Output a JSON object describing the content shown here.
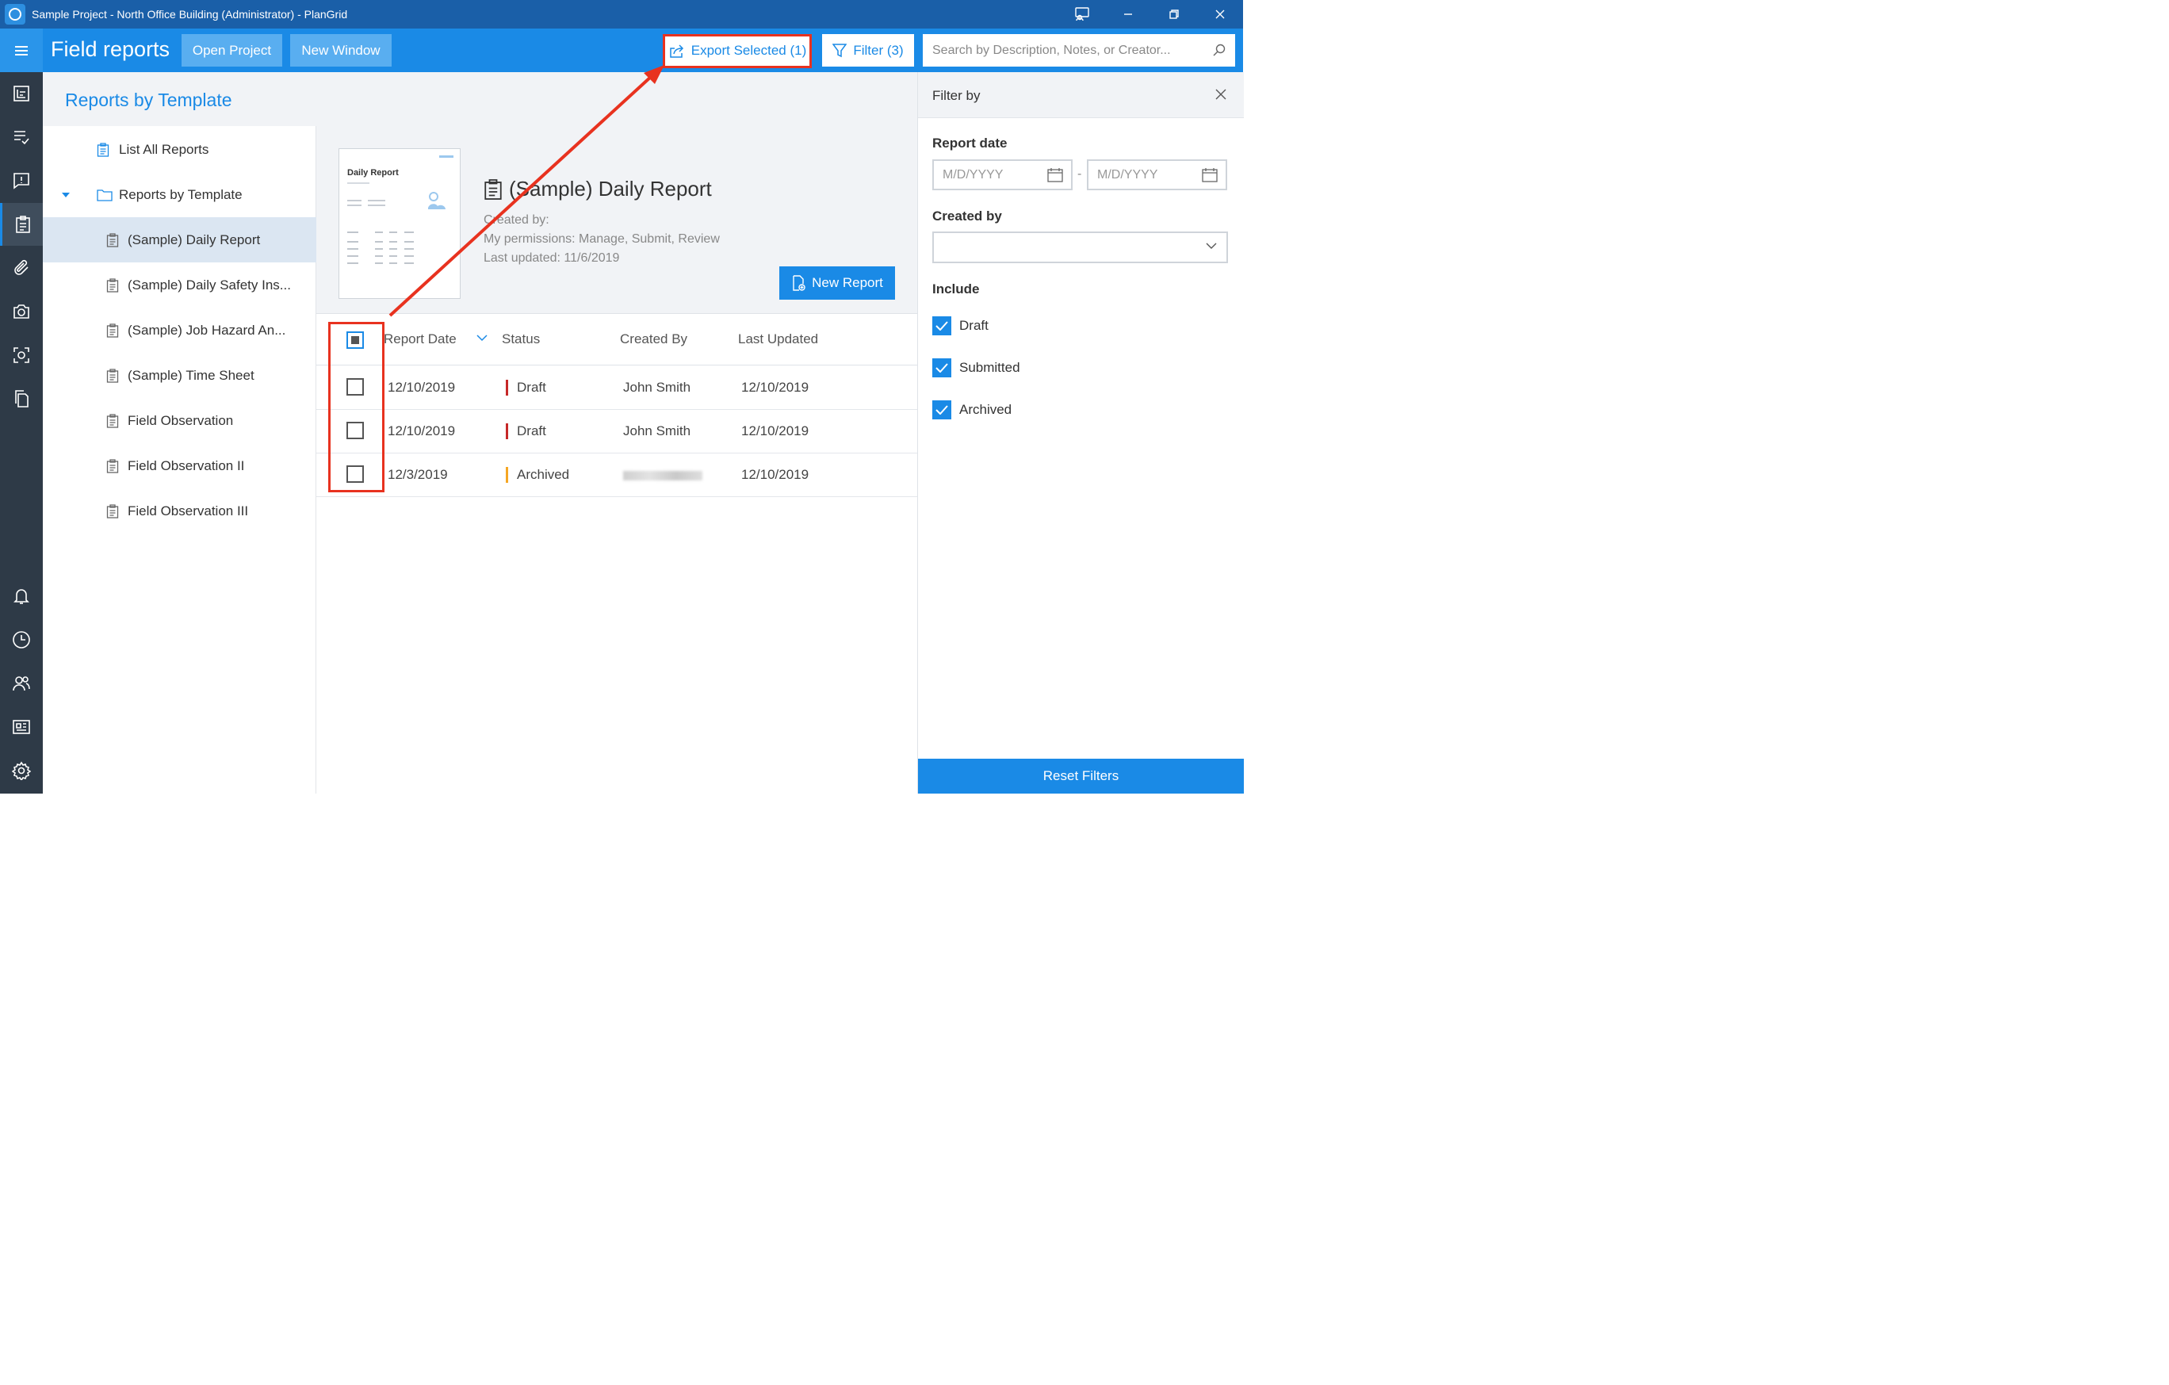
{
  "window": {
    "title": "Sample Project - North Office Building (Administrator) - PlanGrid"
  },
  "header": {
    "title": "Field reports",
    "open_project": "Open Project",
    "new_window": "New Window",
    "export_selected": "Export Selected (1)",
    "filter": "Filter (3)",
    "search_placeholder": "Search by Description, Notes, or Creator..."
  },
  "rail": {
    "items": [
      "sheets",
      "tasks",
      "issues",
      "field-reports",
      "attachments",
      "photos",
      "capture",
      "documents",
      "notifications",
      "history",
      "team",
      "publish-log",
      "settings"
    ],
    "active": "field-reports"
  },
  "templates": {
    "title": "Reports by Template",
    "list_all": "List All Reports",
    "folder": "Reports by Template",
    "items": [
      "(Sample) Daily Report",
      "(Sample) Daily Safety Ins...",
      "(Sample) Job Hazard An...",
      "(Sample) Time Sheet",
      "Field Observation",
      "Field Observation II",
      "Field Observation III"
    ],
    "active_index": 0
  },
  "report": {
    "thumb_title": "Daily Report",
    "title": "(Sample) Daily Report",
    "created_by": "Created by:",
    "permissions": "My permissions: Manage, Submit, Review",
    "last_updated": "Last updated: 11/6/2019",
    "new_report": "New Report"
  },
  "table": {
    "columns": [
      "Report Date",
      "Status",
      "Created By",
      "Last Updated"
    ],
    "rows": [
      {
        "date": "12/10/2019",
        "status": "Draft",
        "status_color": "#c62828",
        "creator": "John Smith",
        "updated": "12/10/2019"
      },
      {
        "date": "12/10/2019",
        "status": "Draft",
        "status_color": "#c62828",
        "creator": "John Smith",
        "updated": "12/10/2019"
      },
      {
        "date": "12/3/2019",
        "status": "Archived",
        "status_color": "#f5a623",
        "creator": "",
        "updated": "12/10/2019"
      }
    ]
  },
  "filter": {
    "title": "Filter by",
    "report_date": "Report date",
    "date_placeholder": "M/D/YYYY",
    "date_separator": "-",
    "created_by": "Created by",
    "include": "Include",
    "options": [
      "Draft",
      "Submitted",
      "Archived"
    ],
    "reset": "Reset Filters"
  },
  "colors": {
    "accent": "#1a8ae6",
    "titlebar": "#1a5fa8",
    "rail": "#2e3a47",
    "annotation": "#e8321f"
  }
}
